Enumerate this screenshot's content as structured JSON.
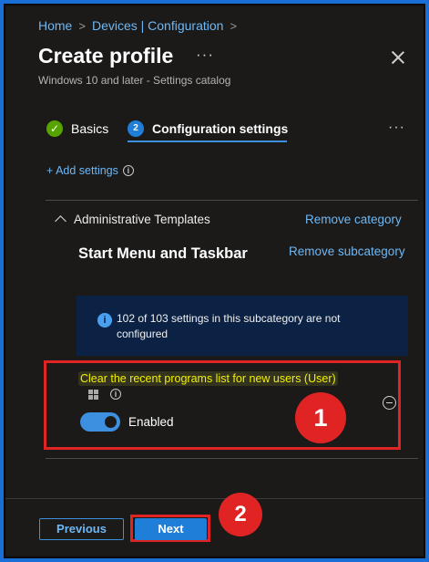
{
  "breadcrumb": {
    "items": [
      "Home",
      "Devices | Configuration"
    ],
    "separator": ">"
  },
  "header": {
    "title": "Create profile",
    "more": "···",
    "subtitle": "Windows 10 and later - Settings catalog"
  },
  "tabs": [
    {
      "label": "Basics",
      "status": "✓"
    },
    {
      "label": "Configuration settings",
      "number": "2"
    }
  ],
  "tabs_more": "···",
  "add_settings": {
    "label": "+ Add settings",
    "info": "i"
  },
  "category": {
    "label": "Administrative Templates",
    "remove_label": "Remove category"
  },
  "subcategory": {
    "label": "Start Menu and Taskbar",
    "remove_label": "Remove subcategory"
  },
  "info_banner": {
    "icon": "i",
    "text": "102 of 103 settings in this subcategory are not configured"
  },
  "setting": {
    "name": "Clear the recent programs list for new users (User)",
    "info": "i",
    "toggle_state": "Enabled",
    "toggle_on": true
  },
  "annotations": {
    "badge1": "1",
    "badge2": "2"
  },
  "footer": {
    "previous_label": "Previous",
    "next_label": "Next"
  },
  "colors": {
    "background": "#1b1a19",
    "link": "#6cb8f6",
    "accent": "#1f7ed8",
    "highlight_red": "#e02424",
    "setting_name": "#f2f200",
    "success": "#57a300"
  },
  "icons": {
    "close": "close-icon",
    "check": "checkmark-circle-icon",
    "info": "info-icon",
    "windows": "windows-icon",
    "remove": "minus-circle-icon",
    "collapse": "chevron-up-icon"
  }
}
